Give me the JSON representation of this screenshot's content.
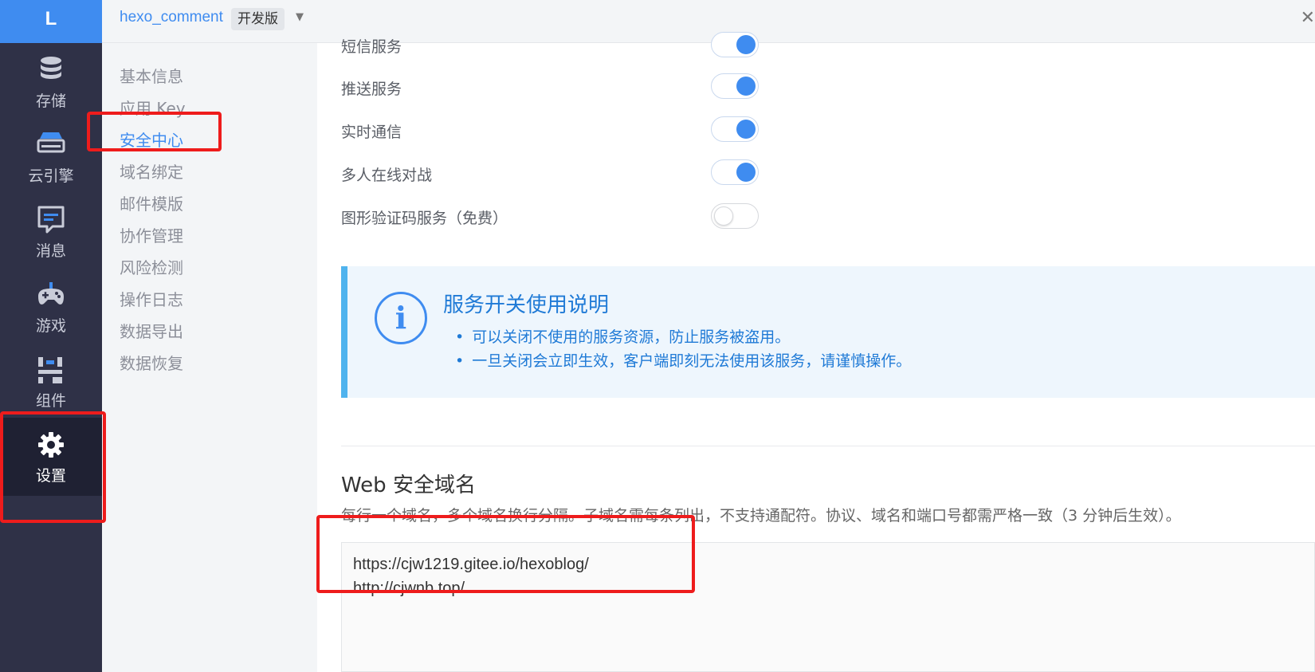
{
  "app": {
    "logo": "L",
    "name": "hexo_comment",
    "edition": "开发版"
  },
  "nav": [
    {
      "label": "存储",
      "icon": "database-icon"
    },
    {
      "label": "云引擎",
      "icon": "server-icon"
    },
    {
      "label": "消息",
      "icon": "message-icon"
    },
    {
      "label": "游戏",
      "icon": "gamepad-icon"
    },
    {
      "label": "组件",
      "icon": "components-icon"
    },
    {
      "label": "设置",
      "icon": "gear-icon",
      "active": true
    }
  ],
  "submenu": [
    "基本信息",
    "应用 Key",
    "安全中心",
    "域名绑定",
    "邮件模版",
    "协作管理",
    "风险检测",
    "操作日志",
    "数据导出",
    "数据恢复"
  ],
  "submenu_active": "安全中心",
  "services": [
    {
      "label": "短信服务",
      "enabled": true
    },
    {
      "label": "推送服务",
      "enabled": true
    },
    {
      "label": "实时通信",
      "enabled": true
    },
    {
      "label": "多人在线对战",
      "enabled": true
    },
    {
      "label": "图形验证码服务（免费）",
      "enabled": false
    }
  ],
  "info": {
    "title": "服务开关使用说明",
    "items": [
      "可以关闭不使用的服务资源，防止服务被盗用。",
      "一旦关闭会立即生效，客户端即刻无法使用该服务，请谨慎操作。"
    ]
  },
  "web_domains": {
    "title": "Web 安全域名",
    "description": "每行一个域名，多个域名换行分隔。子域名需每条列出，不支持通配符。协议、域名和端口号都需严格一致（3 分钟后生效）。",
    "value": "https://cjw1219.gitee.io/hexoblog/\nhttp://cjwnb.top/"
  },
  "colors": {
    "accent": "#3f8cf0",
    "sidebar": "#2f3147",
    "annotation": "#ee1c1c"
  }
}
